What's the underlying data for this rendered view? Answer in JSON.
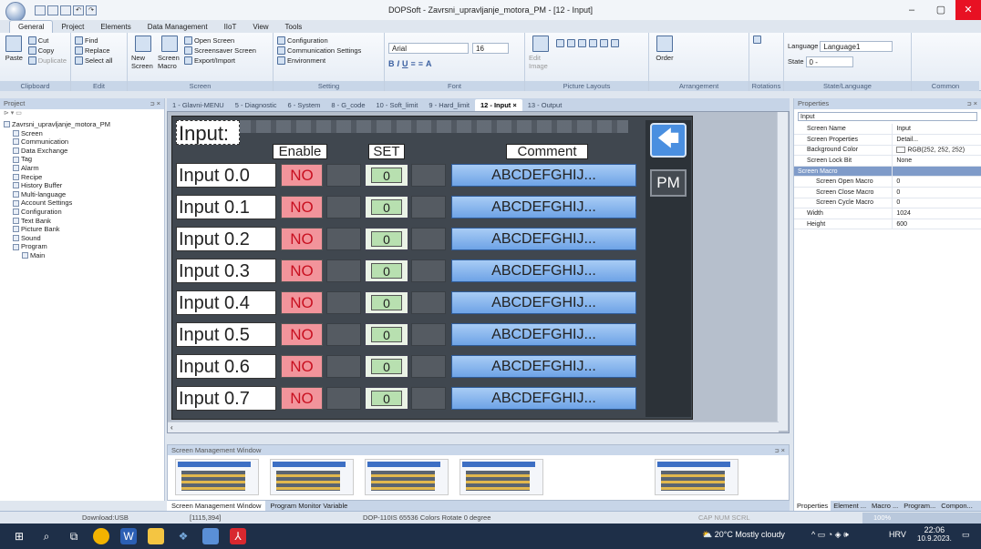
{
  "window": {
    "title": "DOPSoft - Zavrsni_upravljanje_motora_PM - [12 - Input]",
    "min": "–",
    "max": "▢",
    "close": "✕"
  },
  "menu": [
    "General",
    "Project",
    "Elements",
    "Data Management",
    "IIoT",
    "View",
    "Tools"
  ],
  "ribbon": {
    "clipboard": {
      "paste": "Paste",
      "cut": "Cut",
      "copy": "Copy",
      "duplicate": "Duplicate",
      "label": "Clipboard"
    },
    "edit": {
      "find": "Find",
      "replace": "Replace",
      "select_all": "Select all",
      "label": "Edit"
    },
    "screen": {
      "new": "New Screen",
      "macro": "Screen Macro",
      "open": "Open Screen",
      "saver": "Screensaver Screen",
      "export": "Export/Import",
      "label": "Screen"
    },
    "setting": {
      "config": "Configuration",
      "comm": "Communication Settings",
      "env": "Environment",
      "label": "Setting"
    },
    "font": {
      "family": "Arial",
      "size": "16",
      "label": "Font"
    },
    "picture": {
      "edit_image": "Edit Image",
      "label": "Picture Layouts"
    },
    "arrangement": {
      "order": "Order",
      "label": "Arrangement"
    },
    "rotations": {
      "label": "Rotations"
    },
    "state": {
      "language_label": "Language",
      "language_value": "Language1",
      "state_label": "State",
      "state_value": "0 -",
      "label": "State/Language"
    },
    "common": {
      "label": "Common"
    }
  },
  "project_panel": {
    "title": "Project",
    "pin": "ᴝ ×",
    "items": [
      {
        "label": "Zavrsni_upravljanje_motora_PM",
        "indent": 0
      },
      {
        "label": "Screen",
        "indent": 1
      },
      {
        "label": "Communication",
        "indent": 1
      },
      {
        "label": "Data Exchange",
        "indent": 1
      },
      {
        "label": "Tag",
        "indent": 1
      },
      {
        "label": "Alarm",
        "indent": 1
      },
      {
        "label": "Recipe",
        "indent": 1
      },
      {
        "label": "History Buffer",
        "indent": 1
      },
      {
        "label": "Multi-language",
        "indent": 1
      },
      {
        "label": "Account Settings",
        "indent": 1
      },
      {
        "label": "Configuration",
        "indent": 1
      },
      {
        "label": "Text Bank",
        "indent": 1
      },
      {
        "label": "Picture Bank",
        "indent": 1
      },
      {
        "label": "Sound",
        "indent": 1
      },
      {
        "label": "Program",
        "indent": 1
      },
      {
        "label": "Main",
        "indent": 2
      }
    ]
  },
  "tabs": [
    {
      "label": "1 - Glavni-MENU",
      "active": false
    },
    {
      "label": "5 - Diagnostic",
      "active": false
    },
    {
      "label": "6 - System",
      "active": false
    },
    {
      "label": "8 - G_code",
      "active": false
    },
    {
      "label": "10 - Soft_limit",
      "active": false
    },
    {
      "label": "9 - Hard_limit",
      "active": false
    },
    {
      "label": "12 - Input  ×",
      "active": true
    },
    {
      "label": "13 - Output",
      "active": false
    }
  ],
  "hmi": {
    "title": "Input:",
    "col_enable": "Enable",
    "col_set": "SET",
    "col_comment": "Comment",
    "back_symbol": "🡄",
    "pm": "PM",
    "rows": [
      {
        "label": "Input 0.0",
        "enable": "NO",
        "set": "0",
        "comment": "ABCDEFGHIJ..."
      },
      {
        "label": "Input 0.1",
        "enable": "NO",
        "set": "0",
        "comment": "ABCDEFGHIJ..."
      },
      {
        "label": "Input 0.2",
        "enable": "NO",
        "set": "0",
        "comment": "ABCDEFGHIJ..."
      },
      {
        "label": "Input 0.3",
        "enable": "NO",
        "set": "0",
        "comment": "ABCDEFGHIJ..."
      },
      {
        "label": "Input 0.4",
        "enable": "NO",
        "set": "0",
        "comment": "ABCDEFGHIJ..."
      },
      {
        "label": "Input 0.5",
        "enable": "NO",
        "set": "0",
        "comment": "ABCDEFGHIJ..."
      },
      {
        "label": "Input 0.6",
        "enable": "NO",
        "set": "0",
        "comment": "ABCDEFGHIJ..."
      },
      {
        "label": "Input 0.7",
        "enable": "NO",
        "set": "0",
        "comment": "ABCDEFGHIJ..."
      }
    ]
  },
  "screen_mgmt": {
    "title": "Screen Management Window",
    "tab_active": "Screen Management Window",
    "tab_other": "Program Monitor Variable"
  },
  "properties": {
    "title": "Properties",
    "select": "Input",
    "rows": [
      {
        "k": "Screen Name",
        "v": "Input",
        "type": "row"
      },
      {
        "k": "Screen Properties",
        "v": "Detail...",
        "type": "row"
      },
      {
        "k": "Background Color",
        "v": "RGB(252, 252, 252)",
        "type": "color"
      },
      {
        "k": "Screen Lock Bit",
        "v": "None",
        "type": "row"
      },
      {
        "k": "Screen Macro",
        "v": "",
        "type": "grp"
      },
      {
        "k": "Screen Open Macro",
        "v": "0",
        "type": "sub"
      },
      {
        "k": "Screen Close Macro",
        "v": "0",
        "type": "sub"
      },
      {
        "k": "Screen Cycle Macro",
        "v": "0",
        "type": "sub"
      },
      {
        "k": "Width",
        "v": "1024",
        "type": "row"
      },
      {
        "k": "Height",
        "v": "600",
        "type": "row"
      }
    ],
    "bottom_tabs": [
      "Properties",
      "Element ...",
      "Macro ...",
      "Program...",
      "Compon..."
    ]
  },
  "status": {
    "download": "Download:USB",
    "coords": "[1115,394]",
    "device": "DOP-110IS 65536 Colors Rotate 0 degree",
    "keys": "CAP  NUM  SCRL",
    "zoom": "100%"
  },
  "taskbar": {
    "weather": "20°C  Mostly cloudy",
    "lang": "HRV",
    "time": "22:06",
    "date": "10.9.2023."
  }
}
